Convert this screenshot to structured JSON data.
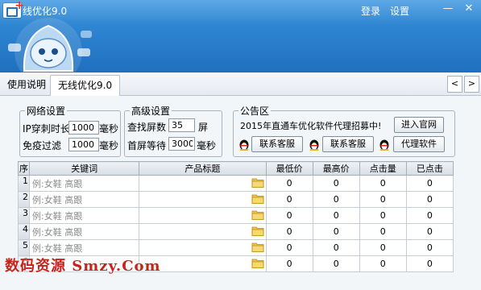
{
  "header": {
    "title": "线优化9.0",
    "login_label": "登录",
    "settings_label": "设置",
    "minimize": "—",
    "close": "✕"
  },
  "tabs": [
    {
      "label": "使用说明"
    },
    {
      "label": "无线优化9.0",
      "active": true
    }
  ],
  "nav": {
    "prev": "<",
    "next": ">"
  },
  "network": {
    "legend": "网络设置",
    "ip_label": "IP穿刺时长",
    "ip_value": "1000",
    "ip_unit": "毫秒",
    "filter_label": "免疫过滤",
    "filter_value": "1000",
    "filter_unit": "毫秒"
  },
  "advanced": {
    "legend": "高级设置",
    "screens_label": "查找屏数",
    "screens_value": "35",
    "screens_unit": "屏",
    "wait_label": "首屏等待",
    "wait_value": "3000",
    "wait_unit": "毫秒"
  },
  "notice": {
    "legend": "公告区",
    "text": "2015年直通车优化软件代理招募中!",
    "website_button": "进入官网",
    "support1": "联系客服",
    "support2": "联系客服",
    "agent": "代理软件"
  },
  "table": {
    "columns": [
      "序",
      "关键词",
      "产品标题",
      "最低价",
      "最高价",
      "点击量",
      "已点击"
    ],
    "rows": [
      {
        "seq": "1",
        "keyword": "例:女鞋 高跟",
        "title": "",
        "min": "0",
        "max": "0",
        "clicks": "0",
        "clicked": "0"
      },
      {
        "seq": "2",
        "keyword": "例:女鞋 高跟",
        "title": "",
        "min": "0",
        "max": "0",
        "clicks": "0",
        "clicked": "0"
      },
      {
        "seq": "3",
        "keyword": "例:女鞋 高跟",
        "title": "",
        "min": "0",
        "max": "0",
        "clicks": "0",
        "clicked": "0"
      },
      {
        "seq": "4",
        "keyword": "例:女鞋 高跟",
        "title": "",
        "min": "0",
        "max": "0",
        "clicks": "0",
        "clicked": "0"
      },
      {
        "seq": "5",
        "keyword": "例:女鞋 高跟",
        "title": "",
        "min": "0",
        "max": "0",
        "clicks": "0",
        "clicked": "0"
      },
      {
        "seq": "6",
        "keyword": "",
        "title": "",
        "min": "0",
        "max": "0",
        "clicks": "0",
        "clicked": "0"
      }
    ]
  },
  "watermark": "数码资源 Smzy.Com",
  "colors": {
    "header": "#2f86d2",
    "watermark": "#c5241c"
  }
}
